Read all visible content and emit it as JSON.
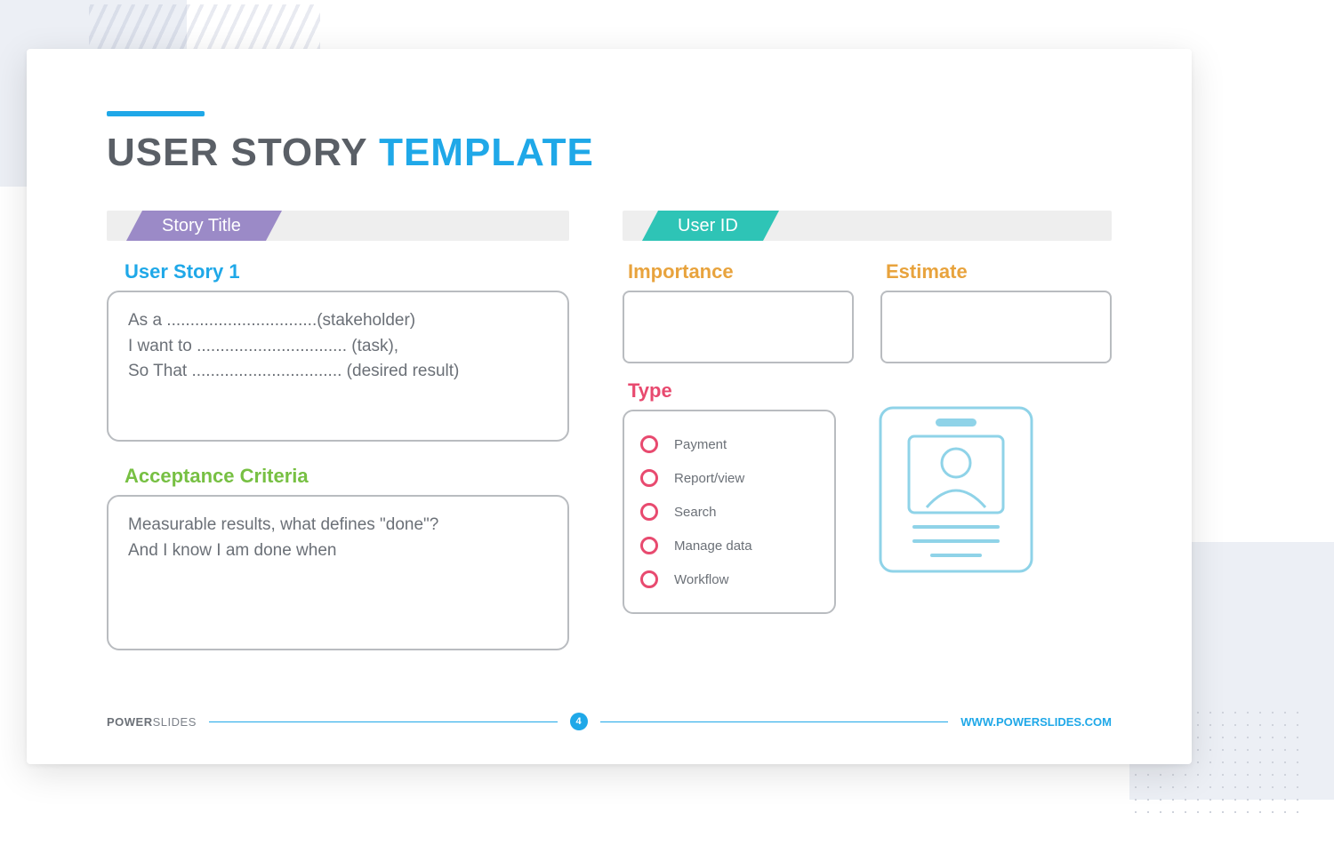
{
  "title": {
    "part1": "USER STORY",
    "part2": "TEMPLATE"
  },
  "left": {
    "tab": "Story Title",
    "story_heading": "User Story 1",
    "story_line1": "As a ................................(stakeholder)",
    "story_line2": "I want to ................................ (task),",
    "story_line3": "So That ................................ (desired result)",
    "criteria_heading": "Acceptance Criteria",
    "criteria_line1": "Measurable results, what defines \"done\"?",
    "criteria_line2": "And I know I am done  when"
  },
  "right": {
    "tab": "User ID",
    "importance_label": "Importance",
    "estimate_label": "Estimate",
    "type_label": "Type",
    "type_options": {
      "o0": "Payment",
      "o1": "Report/view",
      "o2": "Search",
      "o3": "Manage data",
      "o4": "Workflow"
    }
  },
  "footer": {
    "brand_bold": "POWER",
    "brand_light": "SLIDES",
    "page": "4",
    "url": "WWW.POWERSLIDES.COM"
  }
}
